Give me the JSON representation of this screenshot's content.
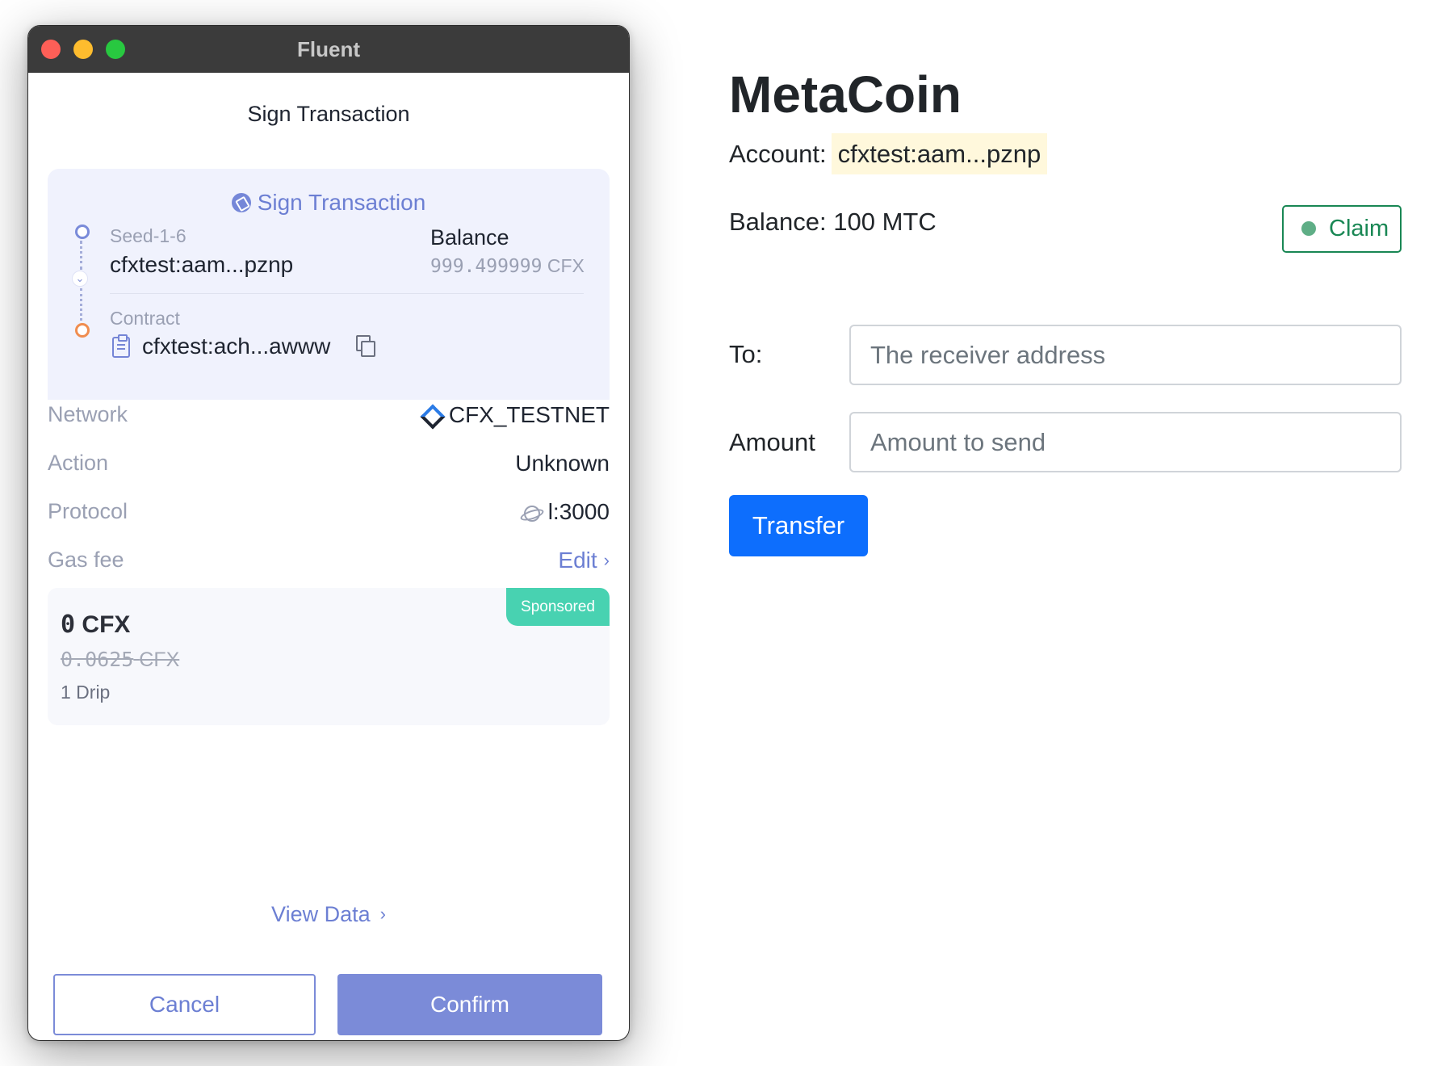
{
  "window": {
    "title": "Fluent"
  },
  "fluent": {
    "header_title": "Sign Transaction",
    "card": {
      "title": "Sign Transaction",
      "from": {
        "label": "Seed-1-6",
        "address": "cfxtest:aam...pznp"
      },
      "balance": {
        "label": "Balance",
        "value": "999.499999",
        "unit": "CFX"
      },
      "contract": {
        "label": "Contract",
        "address": "cfxtest:ach...awww"
      }
    },
    "rows": {
      "network": {
        "label": "Network",
        "value": "CFX_TESTNET"
      },
      "action": {
        "label": "Action",
        "value": "Unknown"
      },
      "protocol": {
        "label": "Protocol",
        "value": "l:3000"
      },
      "gas": {
        "label": "Gas fee",
        "edit_label": "Edit"
      }
    },
    "gas_card": {
      "badge": "Sponsored",
      "fee": "0",
      "fee_unit": "CFX",
      "original_fee": "0.0625",
      "original_unit": "CFX",
      "drip": "1 Drip"
    },
    "view_data_label": "View Data",
    "cancel_label": "Cancel",
    "confirm_label": "Confirm"
  },
  "metacoin": {
    "title": "MetaCoin",
    "account_label": "Account:",
    "account_address": "cfxtest:aam...pznp",
    "balance_text": "Balance: 100 MTC",
    "claim_label": "Claim",
    "to_label": "To:",
    "to_placeholder": "The receiver address",
    "amount_label": "Amount",
    "amount_placeholder": "Amount to send",
    "transfer_label": "Transfer"
  },
  "colors": {
    "fluent_accent": "#7b8bd8",
    "sponsored_badge": "#48d2b1",
    "primary_button": "#0d6efd",
    "claim_green": "#198754",
    "account_highlight": "#fff8dc"
  }
}
